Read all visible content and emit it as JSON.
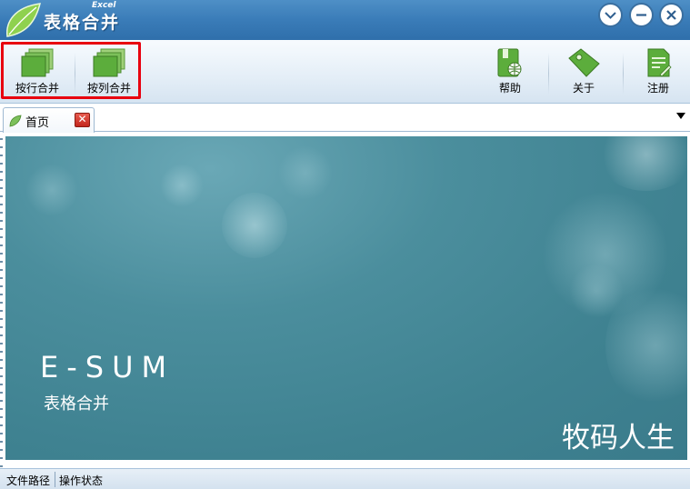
{
  "window": {
    "title": "表格合并",
    "subtitle": "Excel",
    "controls": [
      "minimize-chevron",
      "minimize",
      "close"
    ]
  },
  "toolbar": {
    "merge_rows_label": "按行合并",
    "merge_cols_label": "按列合并",
    "help_label": "帮助",
    "about_label": "关于",
    "register_label": "注册"
  },
  "tabs": [
    {
      "label": "首页",
      "active": true,
      "close_symbol": "✕"
    }
  ],
  "content": {
    "brand": "E-SUM",
    "subtitle": "表格合并",
    "author": "牧码人生"
  },
  "statusbar": {
    "file_path_label": "文件路径",
    "operation_status_label": "操作状态"
  },
  "colors": {
    "title_bar": "#3a7cb8",
    "content_bg": "#4b8e9d",
    "highlight": "#e8000f",
    "icon_green": "#4caa3b"
  }
}
